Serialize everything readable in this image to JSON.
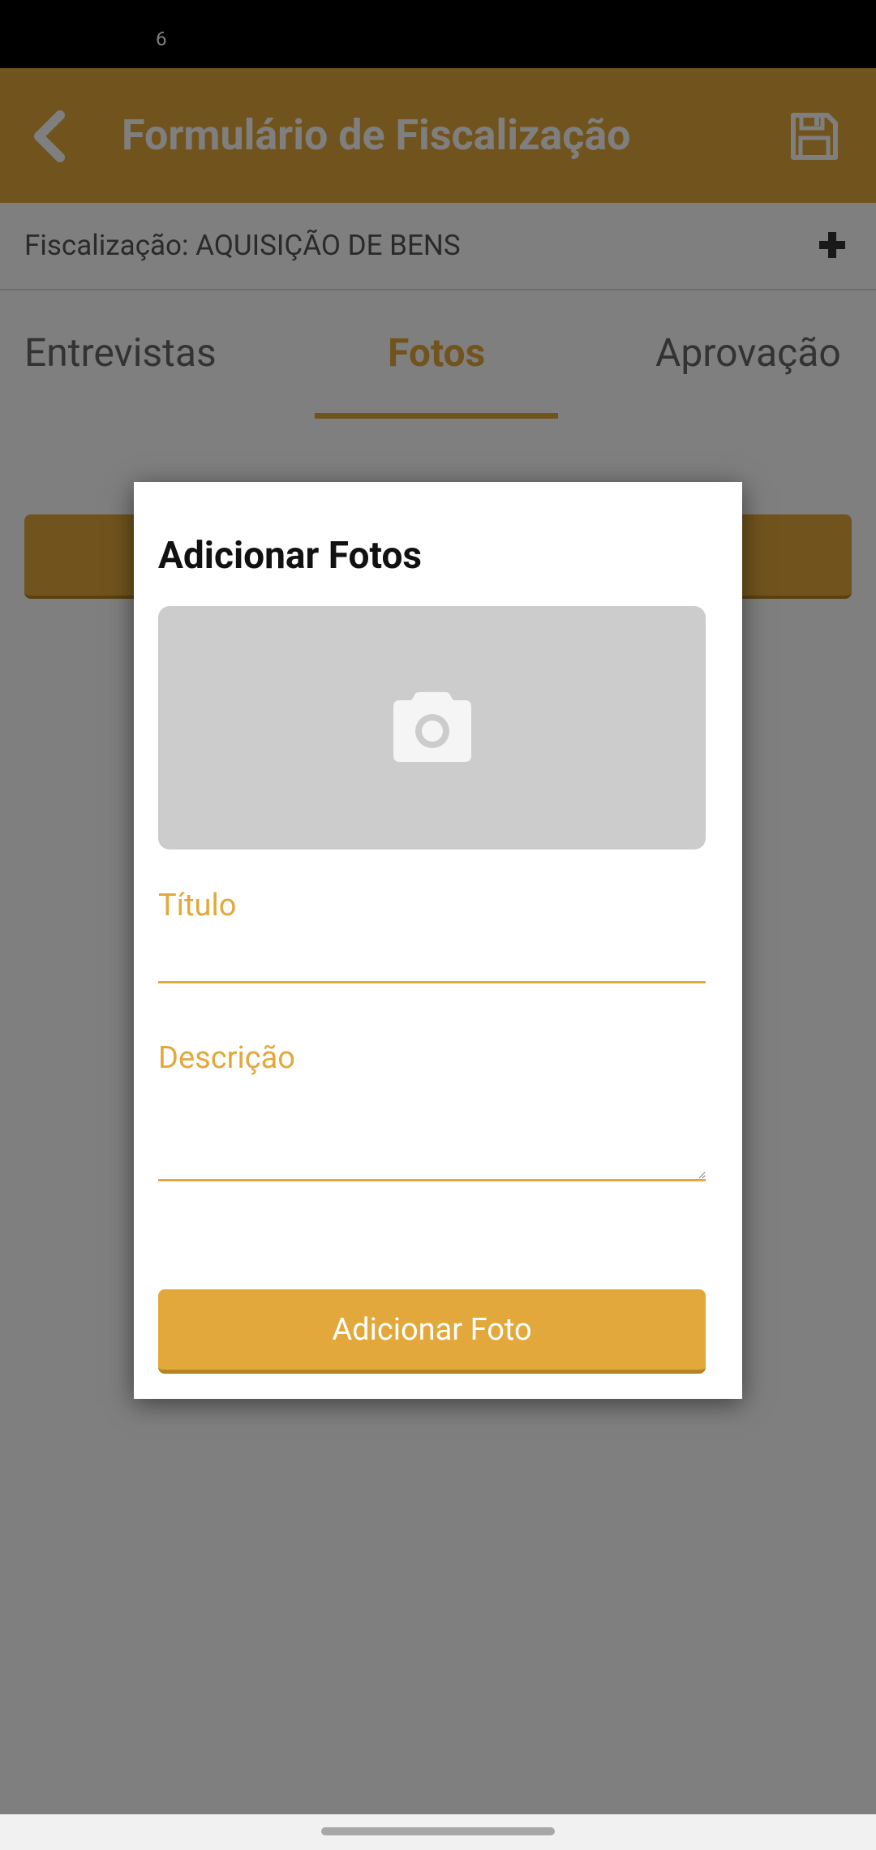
{
  "status_bar": {
    "text": "6"
  },
  "app_bar": {
    "title": "Formulário de Fiscalização",
    "back_icon": "chevron-left-icon",
    "save_icon": "floppy-disk-icon"
  },
  "subheader": {
    "text": "Fiscalização: AQUISIÇÃO DE BENS",
    "add_icon": "plus-icon"
  },
  "tabs": [
    {
      "label": "Entrevistas",
      "active": false
    },
    {
      "label": "Fotos",
      "active": true
    },
    {
      "label": "Aprovação",
      "active": false
    }
  ],
  "dialog": {
    "title": "Adicionar Fotos",
    "photo_placeholder_icon": "camera-icon",
    "titulo_label": "Título",
    "titulo_value": "",
    "descricao_label": "Descrição",
    "descricao_value": "",
    "button_label": "Adicionar Foto"
  },
  "colors": {
    "accent": "#e3a83b",
    "scrim": "rgba(0,0,0,0.5)",
    "photo_box": "#cccccc"
  }
}
